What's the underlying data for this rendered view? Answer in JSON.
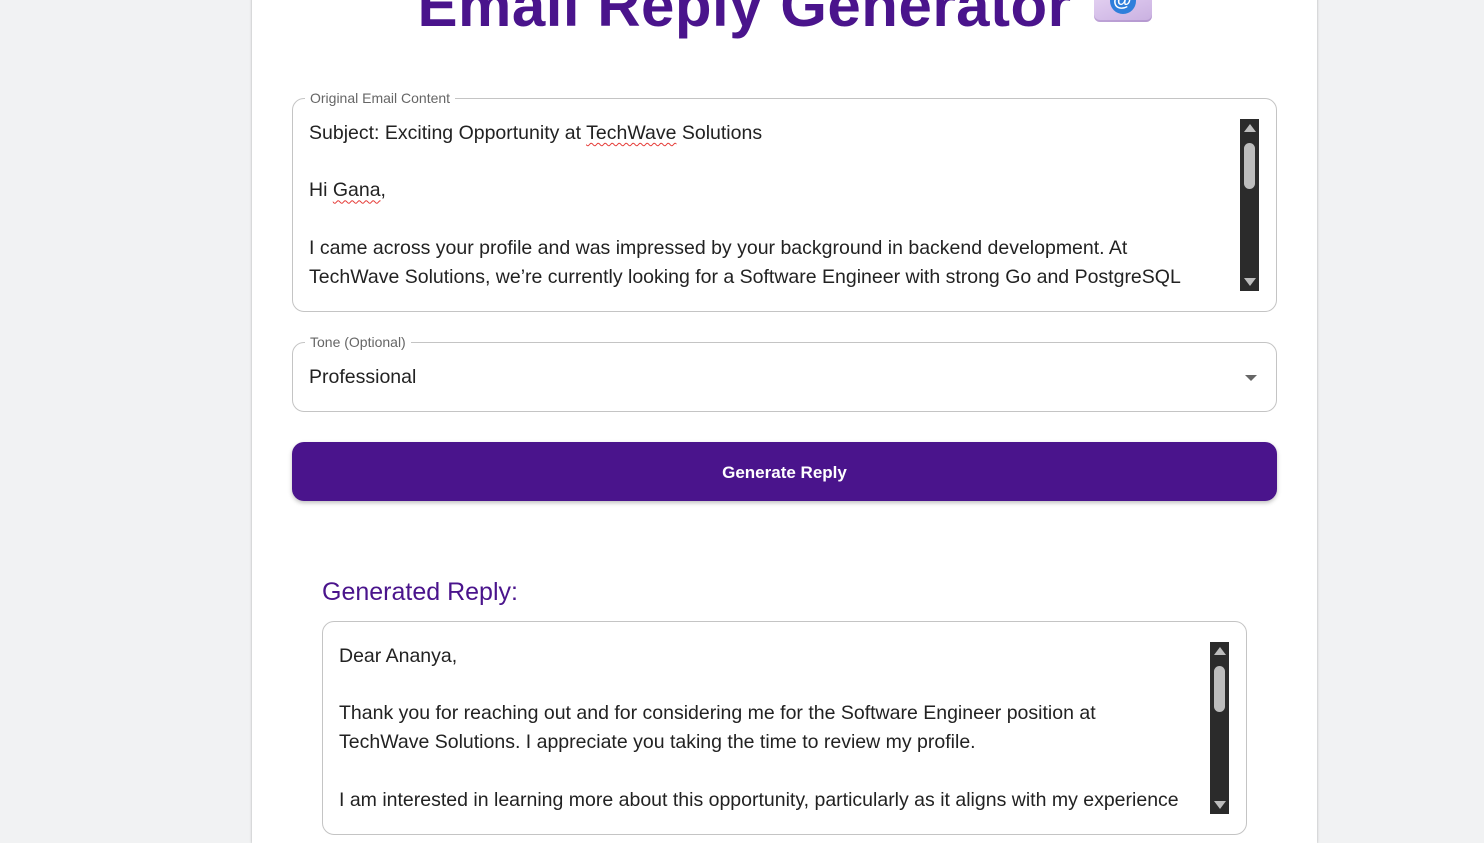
{
  "header": {
    "title": "Email Reply Generator",
    "icon": "email-at-icon"
  },
  "email_field": {
    "label": "Original Email Content",
    "lines": {
      "subject_prefix": "Subject: Exciting Opportunity at ",
      "subject_company": "TechWave",
      "subject_suffix": " Solutions",
      "greeting_prefix": "Hi ",
      "greeting_name": "Gana",
      "greeting_suffix": ",",
      "body_line1": "I came across your profile and was impressed by your background in backend development. At",
      "body_line2": "TechWave Solutions, we’re currently looking for a Software Engineer with strong Go and PostgreSQL"
    }
  },
  "tone_field": {
    "label": "Tone (Optional)",
    "selected": "Professional"
  },
  "generate_button": {
    "label": "Generate Reply"
  },
  "reply": {
    "heading": "Generated Reply:",
    "lines": {
      "salutation": "Dear Ananya,",
      "para1_line1": "Thank you for reaching out and for considering me for the Software Engineer position at",
      "para1_line2": "TechWave Solutions. I appreciate you taking the time to review my profile.",
      "para2_line1": "I am interested in learning more about this opportunity, particularly as it aligns with my experience"
    }
  },
  "colors": {
    "accent": "#4a148c",
    "background": "#f1f2f3",
    "card": "#ffffff"
  }
}
